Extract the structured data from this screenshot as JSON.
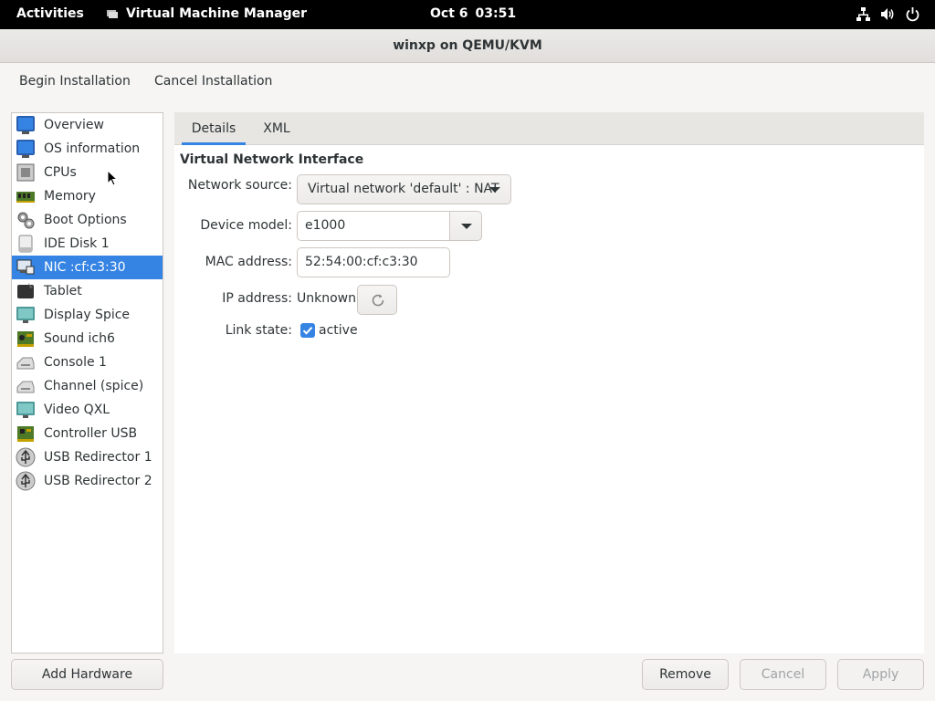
{
  "topbar": {
    "activities": "Activities",
    "app_name": "Virtual Machine Manager",
    "date": "Oct 6",
    "time": "03:51"
  },
  "window": {
    "title": "winxp on QEMU/KVM"
  },
  "toolbar": {
    "begin_label": "Begin Installation",
    "cancel_label": "Cancel Installation"
  },
  "sidebar": {
    "items": [
      {
        "label": "Overview",
        "icon": "monitor-icon"
      },
      {
        "label": "OS information",
        "icon": "monitor-icon"
      },
      {
        "label": "CPUs",
        "icon": "cpu-icon"
      },
      {
        "label": "Memory",
        "icon": "memory-icon"
      },
      {
        "label": "Boot Options",
        "icon": "gears-icon"
      },
      {
        "label": "IDE Disk 1",
        "icon": "disk-icon"
      },
      {
        "label": "NIC :cf:c3:30",
        "icon": "network-card-icon",
        "selected": true
      },
      {
        "label": "Tablet",
        "icon": "tablet-icon"
      },
      {
        "label": "Display Spice",
        "icon": "display-icon"
      },
      {
        "label": "Sound ich6",
        "icon": "sound-card-icon"
      },
      {
        "label": "Console 1",
        "icon": "serial-icon"
      },
      {
        "label": "Channel (spice)",
        "icon": "serial-icon"
      },
      {
        "label": "Video QXL",
        "icon": "display-icon"
      },
      {
        "label": "Controller USB",
        "icon": "controller-icon"
      },
      {
        "label": "USB Redirector 1",
        "icon": "usb-icon"
      },
      {
        "label": "USB Redirector 2",
        "icon": "usb-icon"
      }
    ],
    "add_hardware_label": "Add Hardware"
  },
  "tabs": {
    "details": "Details",
    "xml": "XML"
  },
  "details": {
    "section_title": "Virtual Network Interface",
    "network_source_label": "Network source:",
    "network_source_value": "Virtual network 'default' : NAT",
    "device_model_label": "Device model:",
    "device_model_value": "e1000",
    "mac_label": "MAC address:",
    "mac_value": "52:54:00:cf:c3:30",
    "ip_label": "IP address:",
    "ip_value": "Unknown",
    "link_state_label": "Link state:",
    "link_state_value": "active",
    "link_state_checked": true
  },
  "buttons": {
    "remove": "Remove",
    "cancel": "Cancel",
    "apply": "Apply"
  },
  "colors": {
    "accent": "#3584e4",
    "topbar_bg": "#000000",
    "window_bg": "#f6f5f4"
  }
}
